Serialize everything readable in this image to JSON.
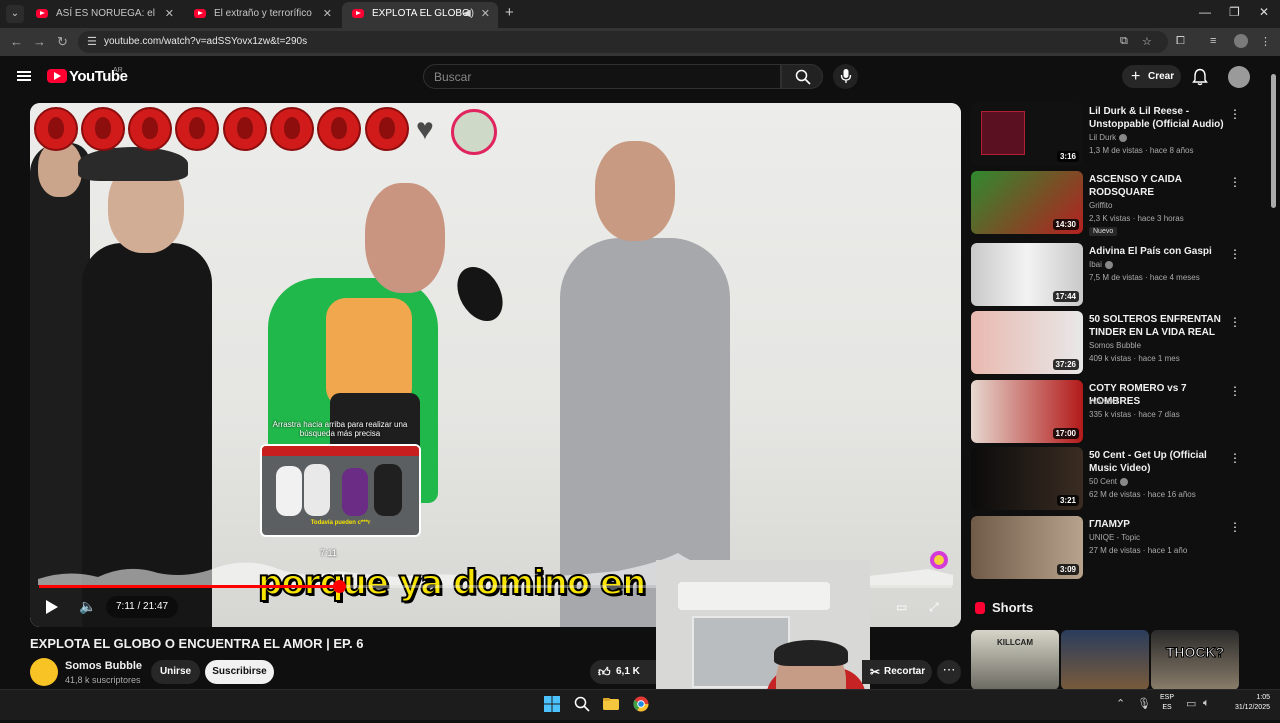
{
  "browser": {
    "tabs": [
      {
        "title": "ASÍ ES NORUEGA: el \"país perfe",
        "active": false
      },
      {
        "title": "El extraño y terrorífico caso de",
        "active": false
      },
      {
        "title": "EXPLOTA EL GLOBO O ENCU",
        "active": true
      }
    ],
    "new_tab": "+",
    "url": "youtube.com/watch?v=adSSYovx1zw&t=290s"
  },
  "youtube": {
    "logo_text": "YouTube",
    "country_code": "AR",
    "search_placeholder": "Buscar",
    "create_label": "Crear"
  },
  "player": {
    "hint_text": "Arrastra hacia arriba para realizar una búsqueda más precisa",
    "preview_time": "7:11",
    "preview_caption": "Todavía pueden c***r",
    "subtitle_text": "porque ya domino en mi v",
    "time_display": "7:11 / 21:47",
    "progress_fraction": 0.329,
    "accent_color": "#ff0000"
  },
  "video": {
    "title": "EXPLOTA EL GLOBO O ENCUENTRA EL AMOR | EP. 6",
    "channel": "Somos Bubble",
    "subscribers": "41,8 k suscriptores",
    "join_label": "Unirse",
    "subscribe_label": "Suscribirse",
    "likes": "6,1 K",
    "clip_label": "Recortar"
  },
  "sidebar": {
    "items": [
      {
        "title": "Lil Durk & Lil Reese - Unstoppable (Official Audio)",
        "channel": "Lil Durk",
        "meta": "1,3 M de vistas · hace 8 años",
        "duration": "3:16",
        "verified": true,
        "badge": ""
      },
      {
        "title": "ASCENSO Y CAIDA RODSQUARE",
        "channel": "Griffito",
        "meta": "2,3 K vistas · hace 3 horas",
        "duration": "14:30",
        "verified": false,
        "badge": "Nuevo"
      },
      {
        "title": "Adivina El País con Gaspi",
        "channel": "Ibai",
        "meta": "7,5 M de vistas · hace 4 meses",
        "duration": "17:44",
        "verified": true,
        "badge": ""
      },
      {
        "title": "50 SOLTEROS ENFRENTAN TINDER EN LA VIDA REAL",
        "channel": "Somos Bubble",
        "meta": "409 k vistas · hace 1 mes",
        "duration": "37:26",
        "verified": false,
        "badge": ""
      },
      {
        "title": "COTY ROMERO vs 7 HOMBRES",
        "channel": "WANDII",
        "meta": "335 k vistas · hace 7 días",
        "duration": "17:00",
        "verified": false,
        "badge": ""
      },
      {
        "title": "50 Cent - Get Up (Official Music Video)",
        "channel": "50 Cent",
        "meta": "62 M de vistas · hace 16 años",
        "duration": "3:21",
        "verified": true,
        "badge": ""
      },
      {
        "title": "ГЛАМУР",
        "channel": "UNIQE - Topic",
        "meta": "27 M de vistas · hace 1 año",
        "duration": "3:09",
        "verified": false,
        "badge": ""
      }
    ],
    "shorts_title": "Shorts",
    "shorts": [
      {
        "text": "KILLCAM"
      },
      {
        "text": ""
      },
      {
        "text": "THOCK?"
      }
    ]
  },
  "taskbar": {
    "lang_top": "ESP",
    "lang_bottom": "ES",
    "time": "1:05",
    "date": "31/12/2025"
  },
  "icons": [
    "tab-search-icon",
    "back-icon",
    "forward-icon",
    "reload-icon",
    "site-info-icon",
    "install-icon",
    "star-icon",
    "extensions-icon",
    "media-icon",
    "menu-icon",
    "hamburger-icon",
    "search-icon",
    "mic-icon",
    "plus-icon",
    "bell-icon",
    "play-icon",
    "volume-icon",
    "miniplayer-icon",
    "fullscreen-icon",
    "heart-icon",
    "like-icon",
    "scissors-icon",
    "more-icon",
    "kebab-icon",
    "shorts-icon",
    "windows-icon",
    "chrome-icon",
    "folder-icon"
  ]
}
